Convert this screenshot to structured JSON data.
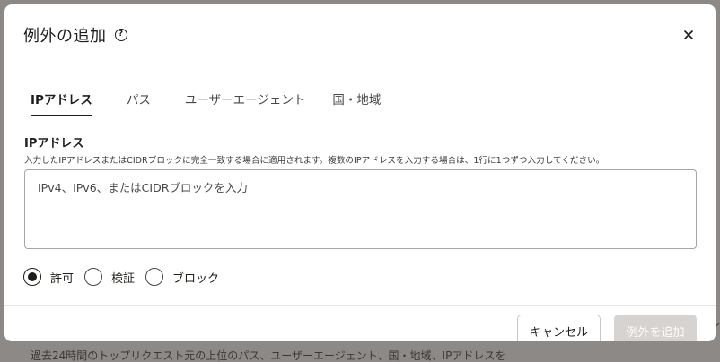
{
  "background": {
    "bottom_text": "過去24時間のトップリクエスト元の上位のパス、ユーザーエージェント、国・地域、IPアドレスを",
    "right_edge_text": "ル"
  },
  "dialog": {
    "title": "例外の追加",
    "help_glyph": "?",
    "close_icon": "close-icon"
  },
  "tabs": [
    {
      "label": "IPアドレス",
      "active": true
    },
    {
      "label": "パス",
      "active": false
    },
    {
      "label": "ユーザーエージェント",
      "active": false
    },
    {
      "label": "国・地域",
      "active": false
    }
  ],
  "field": {
    "label": "IPアドレス",
    "description": "入力したIPアドレスまたはCIDRブロックに完全一致する場合に適用されます。複数のIPアドレスを入力する場合は、1行に1つずつ入力してください。",
    "placeholder": "IPv4、IPv6、またはCIDRブロックを入力",
    "value": ""
  },
  "actions": [
    {
      "label": "許可",
      "checked": true
    },
    {
      "label": "検証",
      "checked": false
    },
    {
      "label": "ブロック",
      "checked": false
    }
  ],
  "footer": {
    "cancel_label": "キャンセル",
    "submit_label": "例外を追加",
    "submit_disabled": true
  },
  "colors": {
    "overlay": "#8c8987",
    "primary_text": "#1f1d1a",
    "disabled_button": "#d6d3d1"
  }
}
